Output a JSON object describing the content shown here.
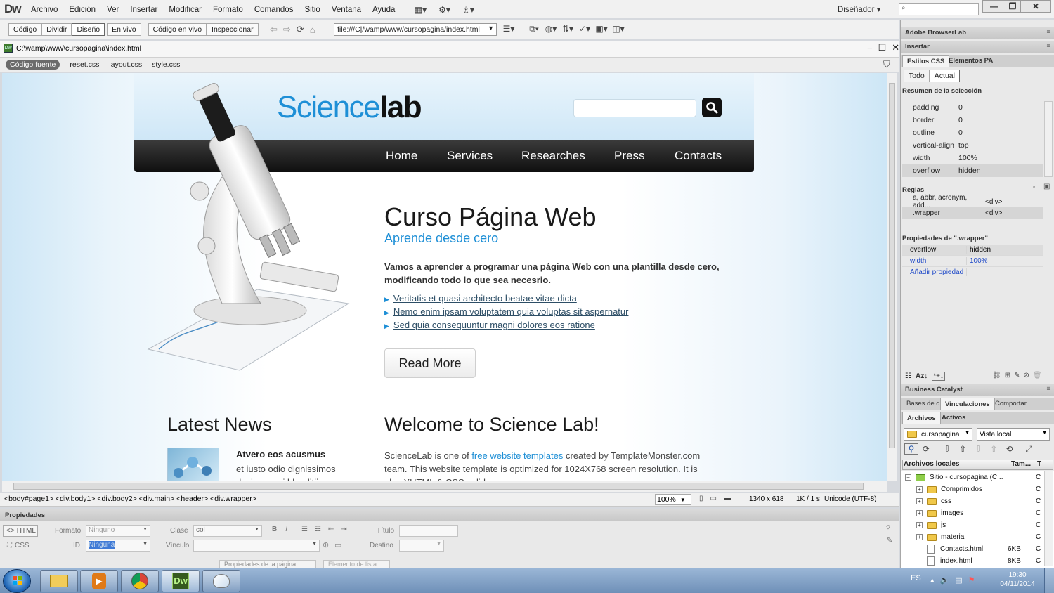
{
  "app": {
    "logo": "Dw",
    "menus": [
      "Archivo",
      "Edición",
      "Ver",
      "Insertar",
      "Modificar",
      "Formato",
      "Comandos",
      "Sitio",
      "Ventana",
      "Ayuda"
    ],
    "workspace": "Diseñador"
  },
  "doc_toolbar": {
    "views": [
      "Código",
      "Dividir",
      "Diseño",
      "En vivo"
    ],
    "active_view": "Diseño",
    "live_code": "Código en vivo",
    "inspect": "Inspeccionar",
    "address": "file:///C|/wamp/www/cursopagina/index.html"
  },
  "document": {
    "path": "C:\\wamp\\www\\cursopagina\\index.html",
    "related_files": [
      "Código fuente",
      "reset.css",
      "layout.css",
      "style.css"
    ]
  },
  "site": {
    "logo_part1": "Science",
    "logo_part2": "lab",
    "nav": [
      "Home",
      "Services",
      "Researches",
      "Press",
      "Contacts"
    ],
    "hero_title": "Curso Página Web",
    "hero_subtitle": "Aprende desde cero",
    "hero_text": "Vamos a aprender a programar una página Web con una plantilla desde cero, modificando todo lo que sea necesrio.",
    "hero_links": [
      "Veritatis et quasi architecto beatae vitae dicta",
      "Nemo enim ipsam voluptatem quia voluptas sit aspernatur",
      "Sed quia consequuntur magni dolores eos ratione"
    ],
    "read_more": "Read More",
    "news_title": "Latest News",
    "news_head": "Atvero eos acusmus",
    "news_body": "et iusto odio dignissimos ducimus qui blanditiis",
    "welcome_title": "Welcome to Science Lab!",
    "welcome_pre": "ScienceLab is one of ",
    "welcome_link": "free website templates",
    "welcome_post": " created by TemplateMonster.com team. This website template is optimized for 1024X768 screen resolution. It is also XHTML & CSS valid."
  },
  "status": {
    "tags": "<body#page1> <div.body1> <div.body2> <div.main> <header> <div.wrapper>",
    "zoom": "100%",
    "size": "1340 x 618",
    "download": "1K / 1 s",
    "encoding": "Unicode (UTF-8)"
  },
  "properties": {
    "title": "Propiedades",
    "html_btn": "HTML",
    "css_btn": "CSS",
    "format_label": "Formato",
    "format_value": "Ninguno",
    "id_label": "ID",
    "id_value": "Ninguna",
    "class_label": "Clase",
    "class_value": "col",
    "link_label": "Vínculo",
    "title_label": "Título",
    "target_label": "Destino",
    "page_props": "Propiedades de la página...",
    "list_item": "Elemento de lista..."
  },
  "panels": {
    "browserlab": "Adobe BrowserLab",
    "insert": "Insertar",
    "css_tabs": [
      "Estilos CSS",
      "Elementos PA"
    ],
    "mode_tabs": [
      "Todo",
      "Actual"
    ],
    "summary_title": "Resumen de la selección",
    "summary": [
      [
        "padding",
        "0"
      ],
      [
        "border",
        "0"
      ],
      [
        "outline",
        "0"
      ],
      [
        "vertical-align",
        "top"
      ],
      [
        "width",
        "100%"
      ],
      [
        "overflow",
        "hidden"
      ]
    ],
    "rules_title": "Reglas",
    "rules": [
      [
        "a, abbr, acronym, add...",
        "<div>"
      ],
      [
        ".wrapper",
        "<div>"
      ]
    ],
    "props_title": "Propiedades de \".wrapper\"",
    "props": [
      [
        "overflow",
        "hidden"
      ],
      [
        "width",
        "100%"
      ]
    ],
    "add_prop": "Añadir propiedad",
    "business": "Business Catalyst",
    "db_tabs": [
      "Bases de d",
      "Vinculaciones",
      "Comportar"
    ],
    "file_tabs": [
      "Archivos",
      "Activos"
    ],
    "site_select": "cursopagina",
    "view_select": "Vista local",
    "files_header": [
      "Archivos locales",
      "Tam...",
      "T"
    ],
    "files": [
      {
        "name": "Sitio - cursopagina (C...",
        "size": "",
        "type": "C",
        "kind": "root"
      },
      {
        "name": "Comprimidos",
        "size": "",
        "type": "C",
        "kind": "folder"
      },
      {
        "name": "css",
        "size": "",
        "type": "C",
        "kind": "folder"
      },
      {
        "name": "images",
        "size": "",
        "type": "C",
        "kind": "folder"
      },
      {
        "name": "js",
        "size": "",
        "type": "C",
        "kind": "folder"
      },
      {
        "name": "material",
        "size": "",
        "type": "C",
        "kind": "folder"
      },
      {
        "name": "Contacts.html",
        "size": "6KB",
        "type": "C",
        "kind": "file"
      },
      {
        "name": "index.html",
        "size": "8KB",
        "type": "C",
        "kind": "file"
      }
    ]
  },
  "taskbar": {
    "lang": "ES",
    "time": "19:30",
    "date": "04/11/2014",
    "dw_label": "Dw"
  }
}
